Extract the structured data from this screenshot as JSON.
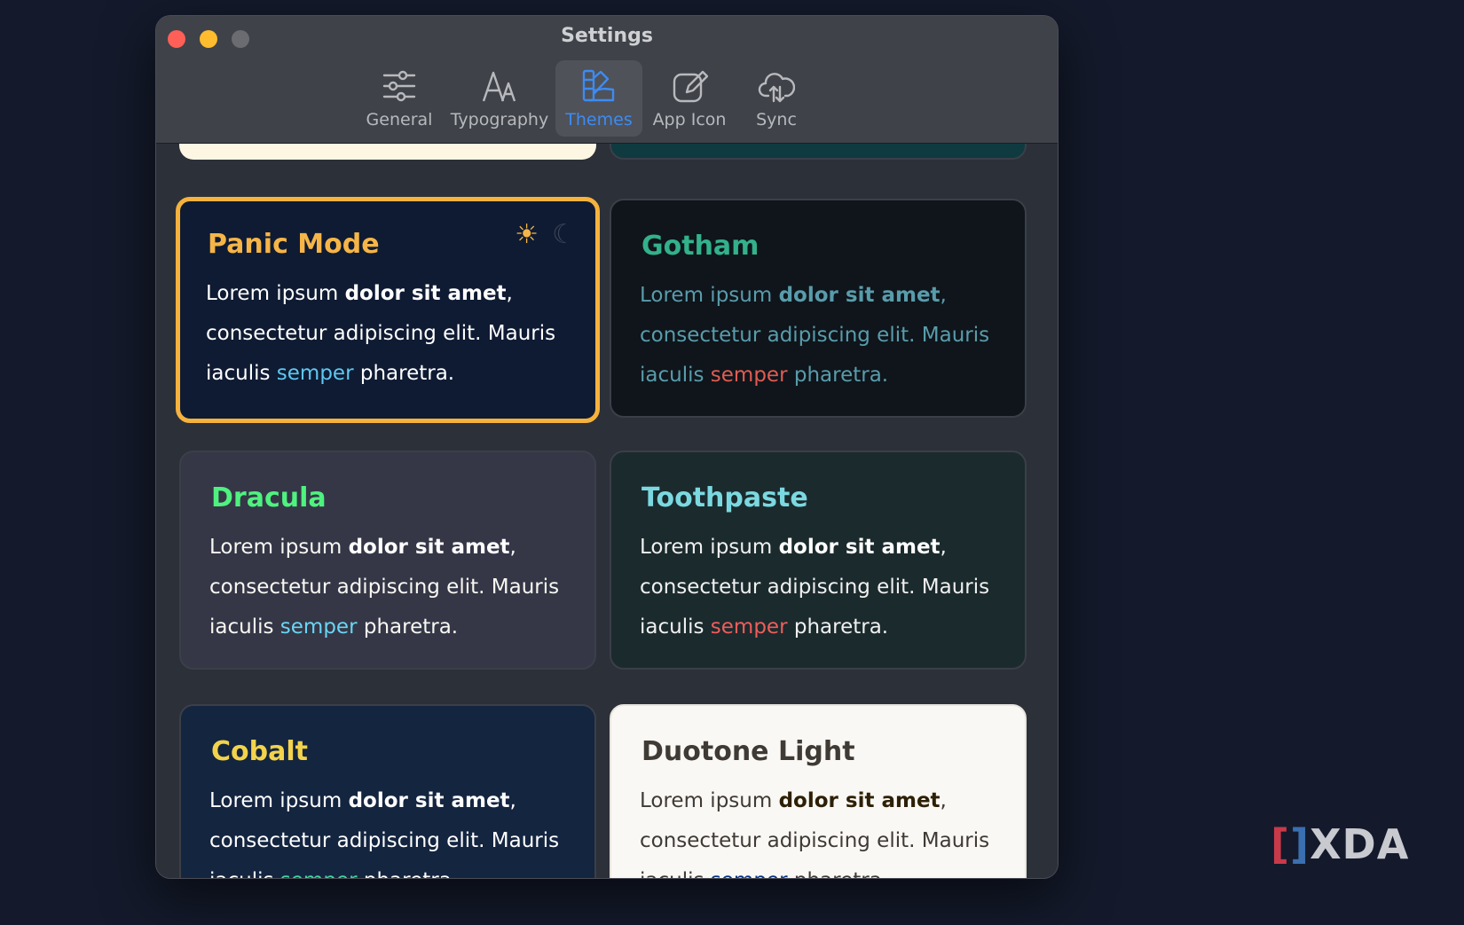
{
  "window": {
    "title": "Settings"
  },
  "tabs": [
    {
      "label": "General",
      "icon": "sliders-icon",
      "active": false
    },
    {
      "label": "Typography",
      "icon": "typography-icon",
      "active": false
    },
    {
      "label": "Themes",
      "icon": "swatches-icon",
      "active": true
    },
    {
      "label": "App Icon",
      "icon": "app-icon-edit-icon",
      "active": false
    },
    {
      "label": "Sync",
      "icon": "cloud-sync-icon",
      "active": false
    }
  ],
  "themes": [
    {
      "name": "Panic Mode",
      "bg": "#0f1b33",
      "name_color": "#f6b547",
      "text": "#ffffff",
      "bold": "#ffffff",
      "accent": "#5ec8f0",
      "selected": true
    },
    {
      "name": "Gotham",
      "bg": "#0f151b",
      "name_color": "#33b18b",
      "text": "#599cab",
      "bold": "#599cab",
      "accent": "#e15c52",
      "selected": false
    },
    {
      "name": "Dracula",
      "bg": "#353747",
      "name_color": "#4ff27f",
      "text": "#f8f8f2",
      "bold": "#ffffff",
      "accent": "#6ad5f3",
      "selected": false
    },
    {
      "name": "Toothpaste",
      "bg": "#1b2a2d",
      "name_color": "#7bd8e0",
      "text": "#f0f0f0",
      "bold": "#ffffff",
      "accent": "#ef5d5b",
      "selected": false
    },
    {
      "name": "Cobalt",
      "bg": "#142540",
      "name_color": "#f2d34b",
      "text": "#ffffff",
      "bold": "#ffffff",
      "accent": "#3ed7a0",
      "selected": false
    },
    {
      "name": "Duotone Light",
      "bg": "#faf8f5",
      "name_color": "#3f3a34",
      "text": "#3f3a34",
      "bold": "#2d2006",
      "accent": "#063289",
      "selected": false
    }
  ],
  "sample": {
    "lead": "Lorem ipsum ",
    "bold": "dolor sit amet",
    "comma": ",",
    "middle": "consectetur adipiscing elit. Mauris",
    "pre_accent": "iaculis ",
    "accent": "semper",
    "post_accent": " pharetra."
  },
  "mode_icons": {
    "light": "sun-icon",
    "dark": "moon-icon"
  },
  "watermark": {
    "text": "XDA"
  },
  "colors": {
    "active_tab": "#3d8bf2",
    "selection_border": "#f5b23d"
  }
}
